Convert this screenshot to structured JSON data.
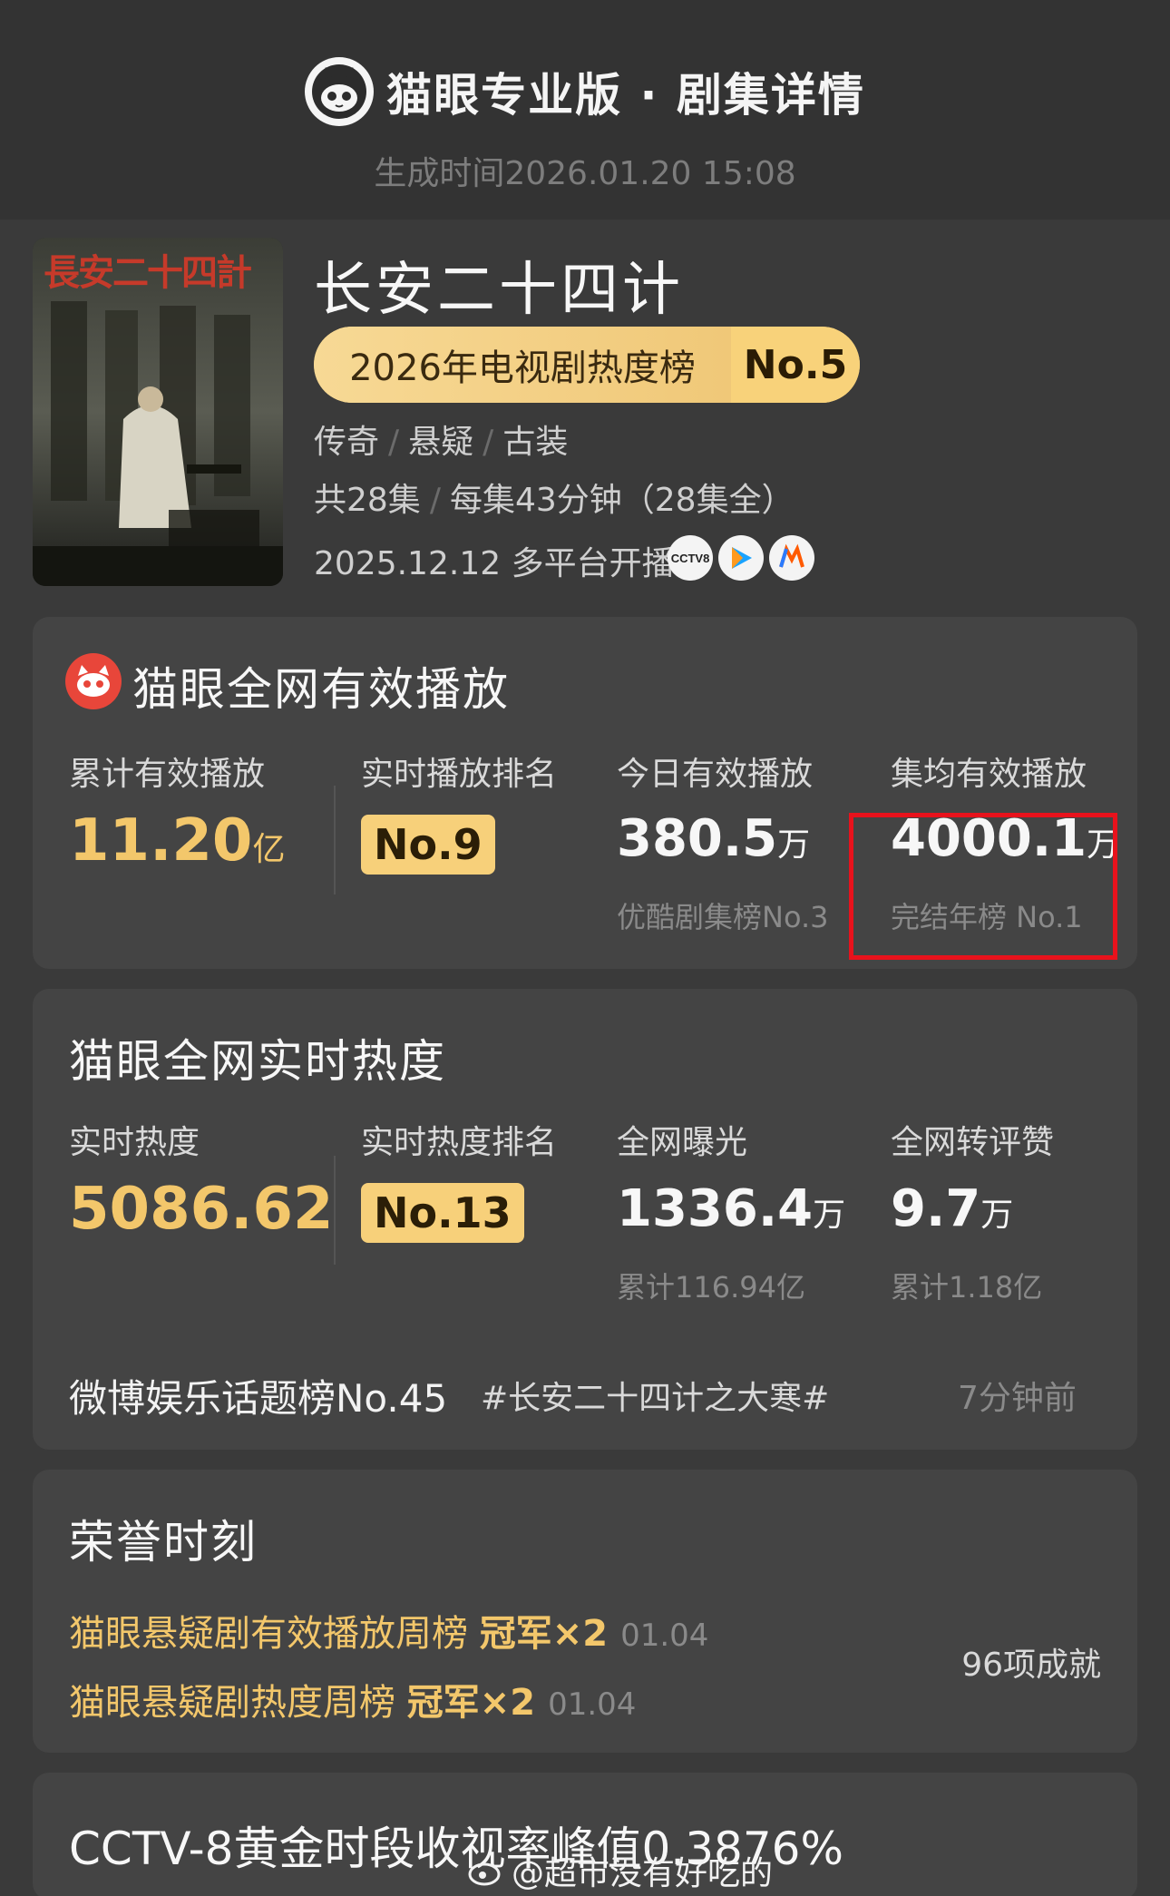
{
  "header": {
    "brand": "猫眼专业版 · 剧集详情",
    "generated_time": "生成时间2026.01.20 15:08"
  },
  "show": {
    "title": "长安二十四计",
    "poster_title": "長安二十四計",
    "rank_label": "2026年电视剧热度榜",
    "rank_value": "No.5",
    "genres": [
      "传奇",
      "悬疑",
      "古装"
    ],
    "episodes": "共28集",
    "duration": "每集43分钟（28集全）",
    "premiere": "2025.12.12 多平台开播",
    "platforms": [
      "cctv8-icon",
      "youku-icon",
      "mgtv-icon"
    ],
    "platform_badge_text": "CCTV8"
  },
  "playback": {
    "title": "猫眼全网有效播放",
    "total_label": "累计有效播放",
    "total_value": "11.20",
    "total_unit": "亿",
    "rank_label": "实时播放排名",
    "rank_value": "No.9",
    "today_label": "今日有效播放",
    "today_value": "380.5",
    "today_unit": "万",
    "today_sub": "优酷剧集榜No.3",
    "avg_label": "集均有效播放",
    "avg_value": "4000.1",
    "avg_unit": "万",
    "avg_sub": "完结年榜 No.1"
  },
  "heat": {
    "title": "猫眼全网实时热度",
    "heat_label": "实时热度",
    "heat_value": "5086.62",
    "rank_label": "实时热度排名",
    "rank_value": "No.13",
    "exposure_label": "全网曝光",
    "exposure_value": "1336.4",
    "exposure_unit": "万",
    "exposure_sub": "累计116.94亿",
    "engage_label": "全网转评赞",
    "engage_value": "9.7",
    "engage_unit": "万",
    "engage_sub": "累计1.18亿",
    "weibo_rank": "微博娱乐话题榜No.45",
    "weibo_topic": "#长安二十四计之大寒#",
    "weibo_time": "7分钟前"
  },
  "honors": {
    "title": "荣誉时刻",
    "items": [
      {
        "text": "猫眼悬疑剧有效播放周榜",
        "award": "冠军×2",
        "date": "01.04"
      },
      {
        "text": "猫眼悬疑剧热度周榜",
        "award": "冠军×2",
        "date": "01.04"
      }
    ],
    "count": "96项成就"
  },
  "ratings": {
    "text": "CCTV-8黄金时段收视率峰值0.3876%"
  },
  "watermark": "@超市没有好吃的"
}
